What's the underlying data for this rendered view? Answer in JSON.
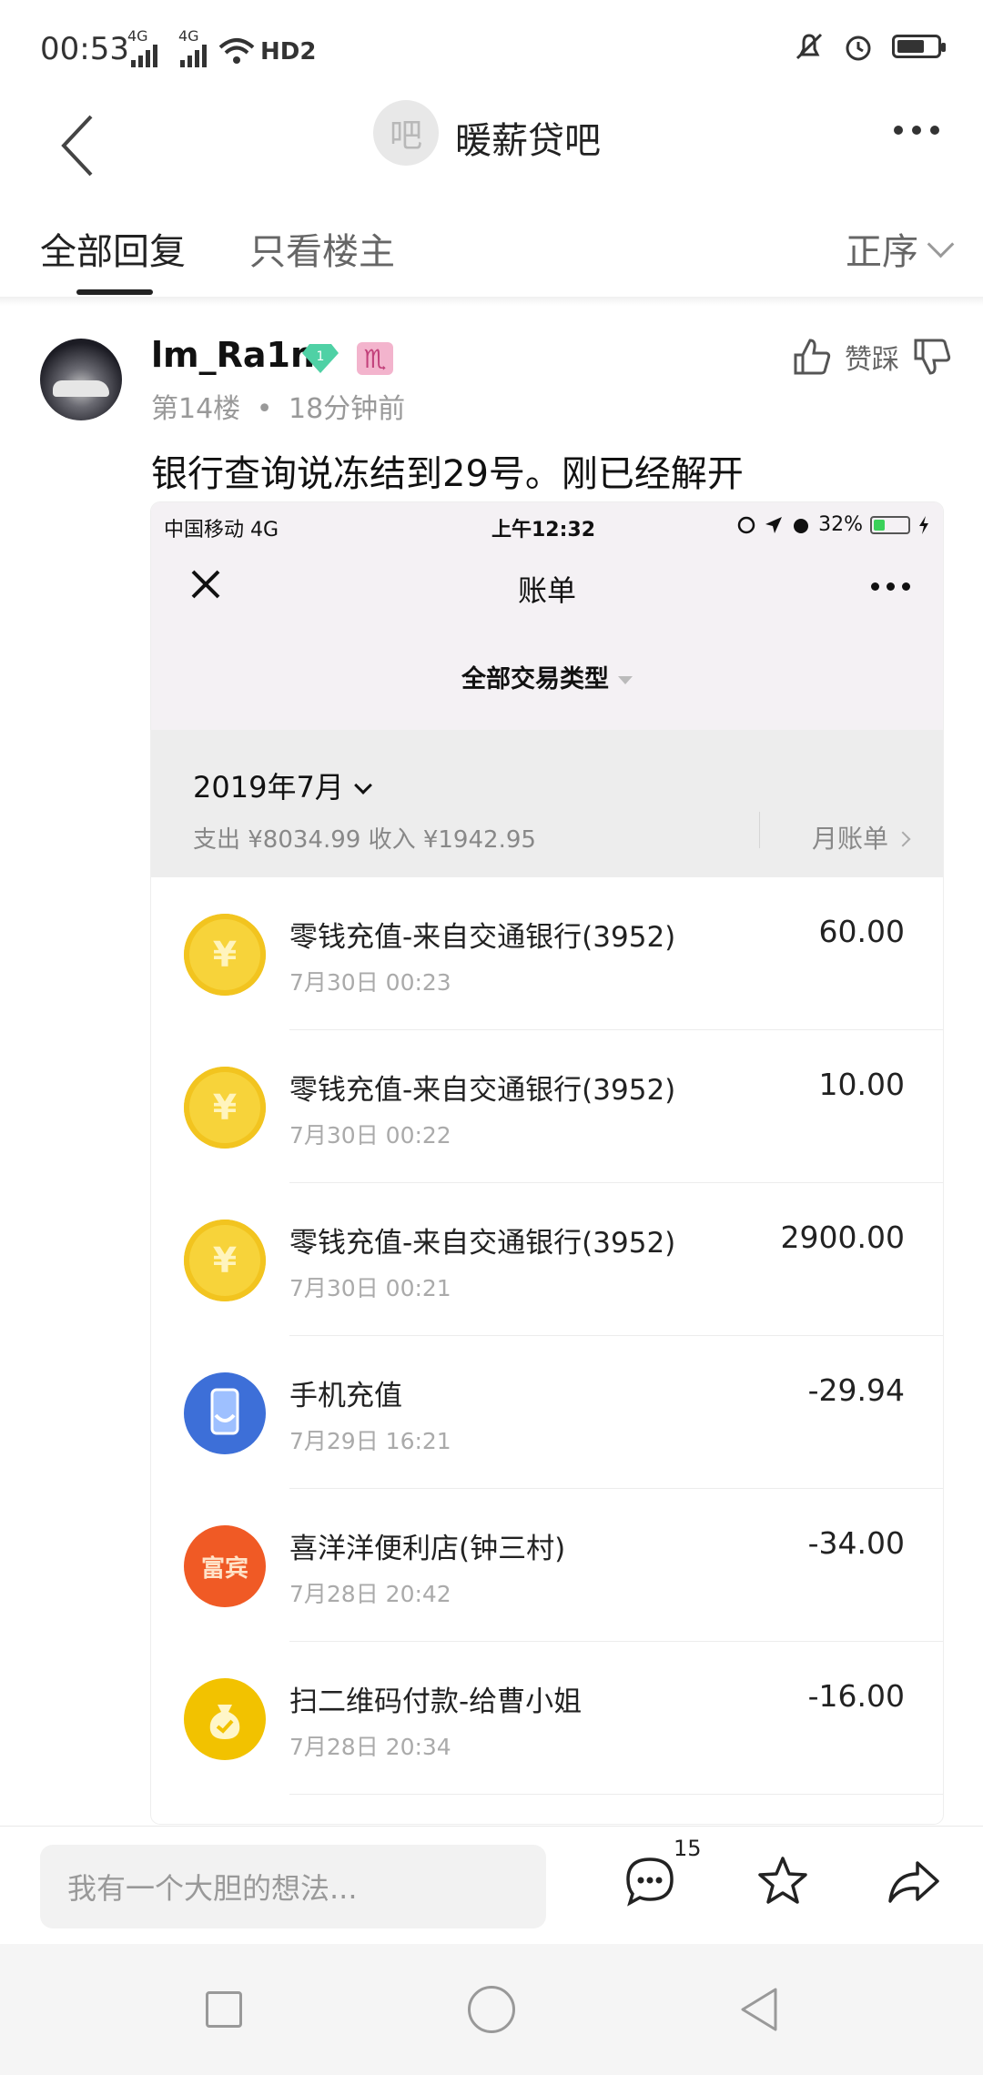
{
  "status_bar": {
    "time": "00:53",
    "signal_1": "4G",
    "signal_2": "4G",
    "hd": "HD2",
    "battery_level": 0.7
  },
  "top_nav": {
    "forum_avatar_glyph": "吧",
    "forum_name": "暖薪贷吧"
  },
  "tabs": {
    "all_replies": "全部回复",
    "op_only": "只看楼主",
    "sort_label": "正序"
  },
  "post": {
    "username": "lm_Ra1n",
    "level_badge": "1",
    "zodiac_badge": "♏",
    "floor": "第14楼",
    "separator": "•",
    "time_ago": "18分钟前",
    "vote_label": "赞踩",
    "text": "银行查询说冻结到29号。刚已经解开"
  },
  "screenshot": {
    "status_bar": {
      "carrier": "中国移动  4G",
      "time": "上午12:32",
      "battery": "32%",
      "battery_level": 0.32
    },
    "title": "账单",
    "filter_label": "全部交易类型",
    "month": {
      "title": "2019年7月",
      "summary": "支出 ¥8034.99 收入 ¥1942.95",
      "bill_link": "月账单"
    },
    "transactions": [
      {
        "icon": "yuan-coin-icon",
        "glyph": "¥",
        "title": "零钱充值-来自交通银行(3952)",
        "time": "7月30日 00:23",
        "amount": "60.00"
      },
      {
        "icon": "yuan-coin-icon",
        "glyph": "¥",
        "title": "零钱充值-来自交通银行(3952)",
        "time": "7月30日 00:22",
        "amount": "10.00"
      },
      {
        "icon": "yuan-coin-icon",
        "glyph": "¥",
        "title": "零钱充值-来自交通银行(3952)",
        "time": "7月30日 00:21",
        "amount": "2900.00"
      },
      {
        "icon": "phone-recharge-icon",
        "glyph": "",
        "title": "手机充值",
        "time": "7月29日 16:21",
        "amount": "-29.94"
      },
      {
        "icon": "shop-logo-icon",
        "glyph": "富宾",
        "title": "喜洋洋便利店(钟三村)",
        "time": "7月28日 20:42",
        "amount": "-34.00"
      },
      {
        "icon": "money-bag-icon",
        "glyph": "",
        "title": "扫二维码付款-给曹小姐",
        "time": "7月28日 20:34",
        "amount": "-16.00"
      }
    ]
  },
  "bottom_bar": {
    "reply_placeholder": "我有一个大胆的想法...",
    "reply_count": "15"
  }
}
